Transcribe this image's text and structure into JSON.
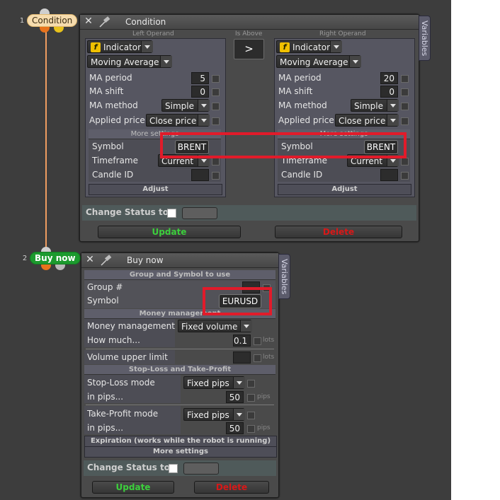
{
  "nodes": {
    "condition": {
      "number": "1",
      "label": "Condition"
    },
    "buy_now": {
      "number": "2",
      "label": "Buy now"
    }
  },
  "condition_window": {
    "title": "Condition",
    "variables_tab": "Variables",
    "left_operand_caption": "Left Operand",
    "is_above_caption": "Is Above",
    "right_operand_caption": "Right Operand",
    "comparison_symbol": ">",
    "left": {
      "source": "Indicator",
      "indicator": "Moving Average",
      "ma_period_label": "MA period",
      "ma_period": "5",
      "ma_shift_label": "MA shift",
      "ma_shift": "0",
      "ma_method_label": "MA method",
      "ma_method": "Simple",
      "applied_price_label": "Applied price",
      "applied_price": "Close price",
      "more_settings": "More settings",
      "symbol_label": "Symbol",
      "symbol": "BRENT",
      "timeframe_label": "Timeframe",
      "timeframe": "Current",
      "candle_id_label": "Candle ID",
      "adjust": "Adjust"
    },
    "right": {
      "source": "Indicator",
      "indicator": "Moving Average",
      "ma_period_label": "MA period",
      "ma_period": "20",
      "ma_shift_label": "MA shift",
      "ma_shift": "0",
      "ma_method_label": "MA method",
      "ma_method": "Simple",
      "applied_price_label": "Applied price",
      "applied_price": "Close price",
      "more_settings": "More settings",
      "symbol_label": "Symbol",
      "symbol": "BRENT",
      "timeframe_label": "Timeframe",
      "timeframe": "Current",
      "candle_id_label": "Candle ID",
      "adjust": "Adjust"
    },
    "change_status_label": "Change Status to",
    "update_label": "Update",
    "delete_label": "Delete"
  },
  "buy_window": {
    "title": "Buy now",
    "variables_tab": "Variables",
    "group_symbol_header": "Group and Symbol to use",
    "group_label": "Group #",
    "symbol_label": "Symbol",
    "symbol": "EURUSD",
    "money_header": "Money management",
    "money_management_label": "Money management",
    "money_management": "Fixed volume",
    "how_much_label": "How much...",
    "how_much": "0.1",
    "lots_unit": "lots",
    "volume_upper_label": "Volume upper limit",
    "sl_tp_header": "Stop-Loss and Take-Profit",
    "sl_mode_label": "Stop-Loss mode",
    "sl_mode": "Fixed pips",
    "sl_pips_label": "in pips...",
    "sl_pips": "50",
    "pips_unit": "pips",
    "tp_mode_label": "Take-Profit mode",
    "tp_mode": "Fixed pips",
    "tp_pips_label": "in pips...",
    "tp_pips": "50",
    "expiration_label": "Expiration (works while the robot is running)",
    "more_settings_label": "More settings",
    "change_status_label": "Change Status to",
    "update_label": "Update",
    "delete_label": "Delete"
  },
  "colors": {
    "highlight": "#e11b2a",
    "update_text": "#3ccf3c",
    "delete_text": "#d81818",
    "connector": "#e8731c"
  }
}
